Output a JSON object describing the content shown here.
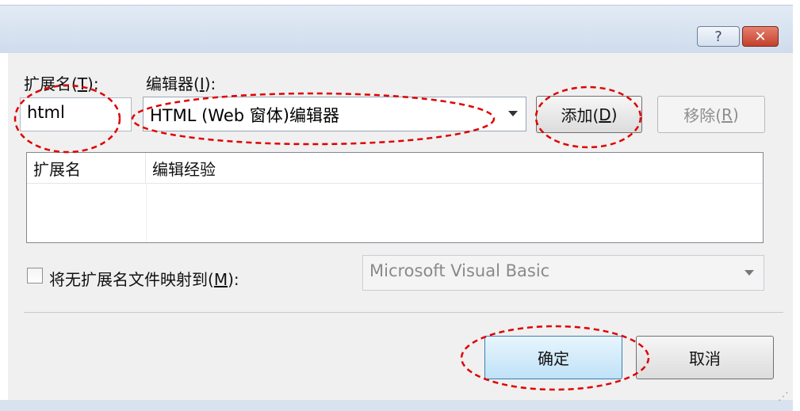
{
  "titlebar": {
    "help_label": "?",
    "close_label": "✕"
  },
  "extension": {
    "label_prefix": "扩展名(",
    "label_key": "T",
    "label_suffix": "):",
    "value": "html"
  },
  "editor": {
    "label_prefix": "编辑器(",
    "label_key": "I",
    "label_suffix": "):",
    "selected": "HTML (Web 窗体)编辑器"
  },
  "buttons": {
    "add_prefix": "添加(",
    "add_key": "D",
    "add_suffix": ")",
    "remove_prefix": "移除(",
    "remove_key": "R",
    "remove_suffix": ")",
    "ok": "确定",
    "cancel": "取消"
  },
  "list": {
    "columns": [
      "扩展名",
      "编辑经验"
    ],
    "rows": []
  },
  "map_no_extension": {
    "label_prefix": "将无扩展名文件映射到(",
    "label_key": "M",
    "label_suffix": "):",
    "checked": false,
    "selected": "Microsoft Visual Basic"
  },
  "annotation_color": "#e00000"
}
